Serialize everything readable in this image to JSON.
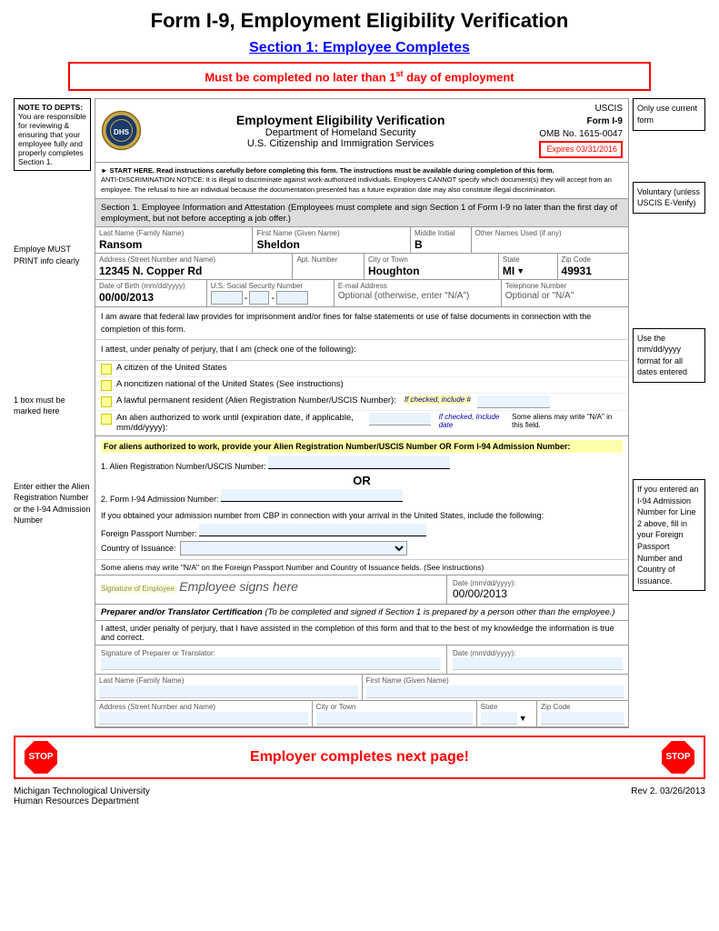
{
  "page": {
    "title": "Form I-9, Employment Eligibility Verification",
    "section_heading": "Section 1: Employee Completes",
    "must_complete": "Must be completed no later than 1",
    "must_complete_sup": "st",
    "must_complete_rest": " day of employment"
  },
  "uscis_form": {
    "title": "Employment Eligibility Verification",
    "dept": "Department of Homeland Security",
    "agency": "U.S. Citizenship and Immigration Services",
    "form_label": "USCIS",
    "form_number": "Form I-9",
    "omb": "OMB No. 1615-0047",
    "expires": "Expires 03/31/2016"
  },
  "notices": {
    "start_here": "► START HERE. Read instructions carefully before completing this form. The instructions must be available during completion of this form.",
    "anti_discrimination": "ANTI-DISCRIMINATION NOTICE: It is illegal to discriminate against work-authorized individuals. Employers CANNOT specify which document(s) they will accept from an employee. The refusal to hire an individual because the documentation presented has a future expiration date may also constitute illegal discrimination."
  },
  "section1": {
    "header": "Section 1. Employee Information and Attestation",
    "header_sub": "(Employees must complete and sign Section 1 of Form I-9 no later than the first day of employment, but not before accepting a job offer.)",
    "fields": {
      "last_name_label": "Last Name (Family Name)",
      "last_name_value": "Ransom",
      "first_name_label": "First Name (Given Name)",
      "first_name_value": "Sheldon",
      "middle_initial_label": "Middle Initial",
      "middle_initial_value": "B",
      "other_names_label": "Other Names Used (if any)",
      "other_names_value": "",
      "address_label": "Address (Street Number and Name)",
      "address_value": "12345 N. Copper Rd",
      "apt_label": "Apt. Number",
      "apt_value": "",
      "city_label": "City or Town",
      "city_value": "Houghton",
      "state_label": "State",
      "state_value": "MI",
      "zip_label": "Zip Code",
      "zip_value": "49931",
      "dob_label": "Date of Birth (mm/dd/yyyy)",
      "dob_value": "00/00/2013",
      "ssn_label": "U.S. Social Security Number",
      "email_label": "E-mail Address",
      "email_placeholder": "Optional (otherwise, enter \"N/A\")",
      "phone_label": "Telephone Number",
      "phone_placeholder": "Optional or \"N/A\""
    }
  },
  "attestation": {
    "aware_text": "I am aware that federal law provides for imprisonment and/or fines for false statements or use of false documents in connection with the completion of this form.",
    "attest_text": "I attest, under penalty of perjury, that I am (check one of the following):",
    "checkboxes": [
      "A citizen of the United States",
      "A noncitizen national of the United States (See instructions)",
      "A lawful permanent resident (Alien Registration Number/USCIS Number):",
      "An alien authorized to work until (expiration date, if applicable, mm/dd/yyyy):"
    ],
    "if_checked_number": "If checked, include #",
    "if_checked_date": "If checked, Include date",
    "some_aliens": "Some aliens may write \"N/A\" in this field.",
    "alien_auth_text": "For aliens authorized to work, provide your Alien Registration Number/USCIS Number OR Form I-94 Admission Number:",
    "line1_label": "1. Alien Registration Number/USCIS Number:",
    "or_label": "OR",
    "line2_label": "2. Form I-94 Admission Number:",
    "cbp_text": "If you obtained your admission number from CBP in connection with your arrival in the United States, include the following:",
    "foreign_passport_label": "Foreign Passport Number:",
    "country_label": "Country of Issuance:",
    "some_aliens_note": "Some aliens may write \"N/A\" on the Foreign Passport Number and Country of Issuance fields. (See instructions)"
  },
  "signature_section": {
    "sig_label": "Signature of Employee:",
    "sig_value": "Employee signs here",
    "date_label": "Date (mm/dd/yyyy):",
    "date_value": "00/00/2013"
  },
  "preparer": {
    "header": "Preparer and/or Translator Certification",
    "header_sub": "(To be completed and signed if Section 1 is prepared by a person other than the employee.)",
    "attest": "I attest, under penalty of perjury, that I have assisted in the completion of this form and that to the best of my knowledge the information is true and correct.",
    "sig_label": "Signature of Preparer or Translator:",
    "date_label": "Date (mm/dd/yyyy):",
    "last_name_label": "Last Name (Family Name)",
    "first_name_label": "First Name (Given Name)",
    "address_label": "Address (Street Number and Name)",
    "city_label": "City or Town",
    "state_label": "State",
    "zip_label": "Zip Code"
  },
  "bottom": {
    "employer_next": "Employer completes next page!",
    "stop": "STOP"
  },
  "footer": {
    "institution": "Michigan Technological University",
    "department": "Human Resources Department",
    "rev": "Rev 2. 03/26/2013"
  },
  "annotations": {
    "note_to_depts": "NOTE TO DEPTS:",
    "note_body": "You are responsible for reviewing & ensuring that your employee fully and properly completes Section 1.",
    "employee_must": "Employe MUST PRINT info clearly",
    "one_box": "1 box must be marked here",
    "enter_alien": "Enter either the Alien Registration Number or the I-94 Admission Number",
    "only_use": "Only use current form",
    "voluntary": "Voluntary (unless USCIS E-Verify)",
    "use_mmddyyyy": "Use the mm/dd/yyyy format for all dates entered",
    "i94_note": "If you entered an I-94 Admission Number for Line 2 above, fill in your Foreign Passport Number and Country of Issuance."
  }
}
